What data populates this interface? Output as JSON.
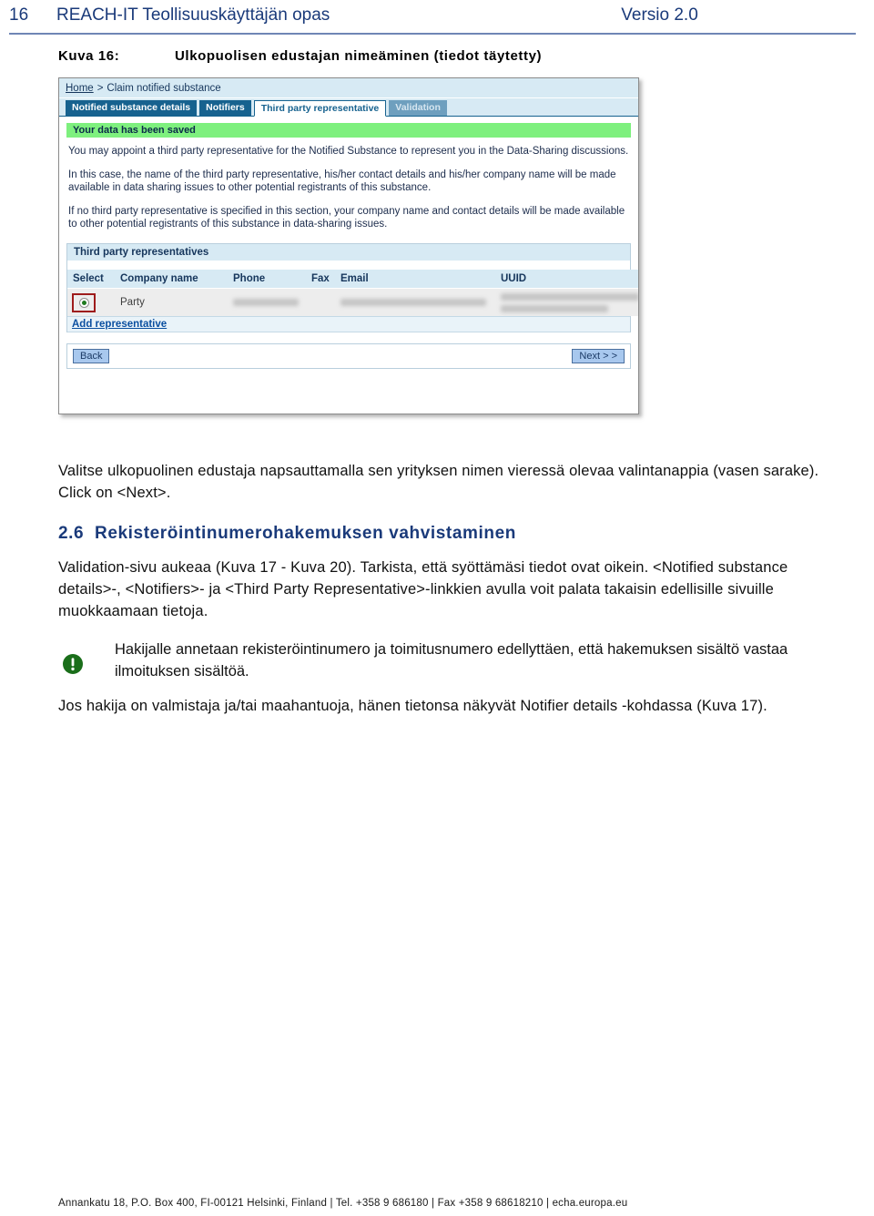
{
  "header": {
    "page_number": "16",
    "title": "REACH-IT Teollisuuskäyttäjän opas",
    "version": "Versio 2.0"
  },
  "figure": {
    "label": "Kuva 16:",
    "caption": "Ulkopuolisen edustajan nimeäminen (tiedot täytetty)"
  },
  "screenshot": {
    "breadcrumb": {
      "home": "Home",
      "separator": ">",
      "current": "Claim notified substance"
    },
    "tabs": [
      {
        "label": "Notified substance details",
        "state": "normal"
      },
      {
        "label": "Notifiers",
        "state": "normal"
      },
      {
        "label": "Third party representative",
        "state": "active"
      },
      {
        "label": "Validation",
        "state": "disabled"
      }
    ],
    "saved_banner": "Your data has been saved",
    "paragraphs": [
      "You may appoint a third party representative for the Notified Substance to represent you in the Data-Sharing discussions.",
      "In this case, the name of the third party representative, his/her contact details and his/her company name will be made available in data sharing issues to other potential registrants of this substance.",
      "If no third party representative is specified in this section, your company name and contact details will be made available to other potential registrants of this substance in data-sharing issues."
    ],
    "panel_title": "Third party representatives",
    "table": {
      "columns": [
        "Select",
        "Company name",
        "Phone",
        "Fax",
        "Email",
        "UUID"
      ],
      "rows": [
        {
          "selected": true,
          "company_name": "Party",
          "phone": "",
          "fax": "",
          "email": "",
          "uuid": ""
        }
      ]
    },
    "add_representative_link": "Add representative",
    "buttons": {
      "back": "Back",
      "next": "Next > >"
    },
    "colors": {
      "tab_active_text": "#17628f",
      "tab_background": "#17628f",
      "banner_green": "#7ef07e",
      "highlight_red": "#9e1b1b",
      "panel_blue": "#d7eaf4"
    }
  },
  "body": {
    "intro_paragraph": "Valitse ulkopuolinen edustaja napsauttamalla sen yrityksen nimen vieressä olevaa valintanappia (vasen sarake). Click on <Next>.",
    "section": {
      "number": "2.6",
      "title": "Rekisteröintinumerohakemuksen vahvistaminen"
    },
    "paragraph_1": "Validation-sivu aukeaa (Kuva 17 - Kuva 20). Tarkista, että syöttämäsi tiedot ovat oikein. <Notified substance details>-, <Notifiers>- ja <Third Party Representative>-linkkien avulla voit palata takaisin edellisille sivuille muokkaamaan tietoja.",
    "note": {
      "icon": "exclamation-circle-icon",
      "icon_color": "#1a6e1a",
      "text": "Hakijalle annetaan rekisteröintinumero ja toimitusnumero edellyttäen, että hakemuksen sisältö vastaa ilmoituksen sisältöä."
    },
    "paragraph_2": "Jos hakija on valmistaja ja/tai maahantuoja, hänen tietonsa näkyvät Notifier details -kohdassa (Kuva 17)."
  },
  "footer": {
    "text": "Annankatu 18, P.O. Box 400, FI-00121 Helsinki, Finland | Tel. +358 9 686180 | Fax +358 9 68618210 | echa.europa.eu"
  }
}
